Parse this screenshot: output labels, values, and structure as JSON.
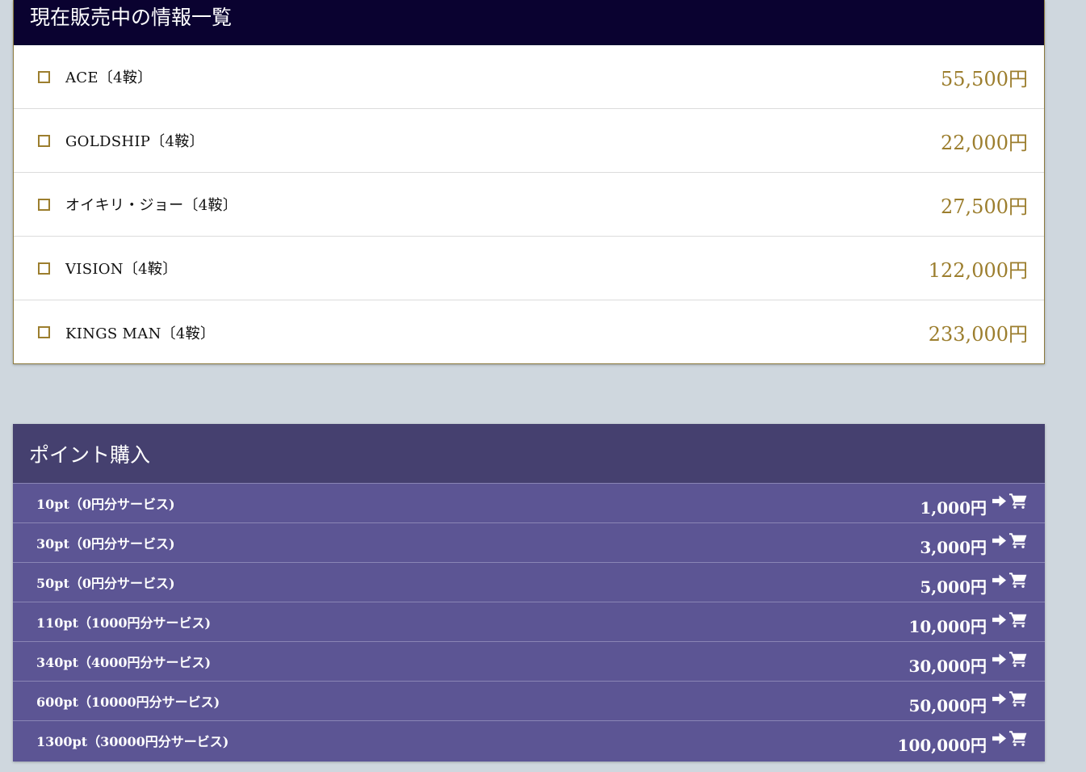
{
  "sale": {
    "title": "現在販売中の情報一覧",
    "items": [
      {
        "name": "ACE〔4鞍〕",
        "price": "55,500円"
      },
      {
        "name": "GOLDSHIP〔4鞍〕",
        "price": "22,000円"
      },
      {
        "name": "オイキリ・ジョー〔4鞍〕",
        "price": "27,500円"
      },
      {
        "name": "VISION〔4鞍〕",
        "price": "122,000円"
      },
      {
        "name": "KINGS MAN〔4鞍〕",
        "price": "233,000円"
      }
    ]
  },
  "points": {
    "title": "ポイント購入",
    "items": [
      {
        "label": "10pt（0円分サービス)",
        "price": "1,000円"
      },
      {
        "label": "30pt（0円分サービス)",
        "price": "3,000円"
      },
      {
        "label": "50pt（0円分サービス)",
        "price": "5,000円"
      },
      {
        "label": "110pt（1000円分サービス)",
        "price": "10,000円"
      },
      {
        "label": "340pt（4000円分サービス)",
        "price": "30,000円"
      },
      {
        "label": "600pt（10000円分サービス)",
        "price": "50,000円"
      },
      {
        "label": "1300pt（30000円分サービス)",
        "price": "100,000円"
      }
    ]
  },
  "icons": {
    "row_arrow": "arrow-right-icon",
    "row_cart": "cart-icon"
  },
  "colors": {
    "background": "#cfd7de",
    "sale_header": "#0a0230",
    "price_gold": "#9c7e2e",
    "point_header": "#45406f",
    "point_row": "#5c5594"
  }
}
